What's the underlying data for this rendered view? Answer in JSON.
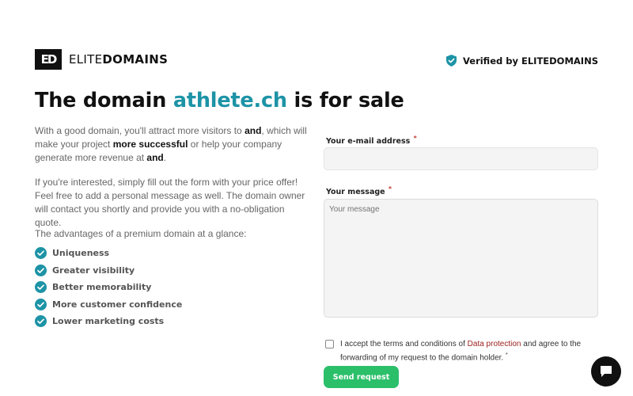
{
  "header": {
    "logo_mark": "ED",
    "logo_light": "ELITE",
    "logo_bold": "DOMAINS",
    "verified_text": "Verified by ELITEDOMAINS"
  },
  "title": {
    "prefix": "The domain ",
    "domain": "athlete.ch",
    "suffix": " is for sale"
  },
  "intro": {
    "p1_a": "With a good domain, you'll attract more visitors to ",
    "p1_b": "and",
    "p1_c": ", which will make your project ",
    "p1_d": "more successful",
    "p1_e": " or help your company generate more revenue at ",
    "p1_f": "and",
    "p1_g": ".",
    "p2": "If you're interested, simply fill out the form with your price offer! Feel free to add a personal message as well. The domain owner will contact you shortly and provide you with a no-obligation quote.",
    "p3": "The advantages of a premium domain at a glance:"
  },
  "advantages": [
    "Uniqueness",
    "Greater visibility",
    "Better memorability",
    "More customer confidence",
    "Lower marketing costs"
  ],
  "form": {
    "email_label": "Your e-mail address",
    "email_value": "",
    "message_label": "Your message",
    "message_placeholder": "Your message",
    "required_mark": "*",
    "terms_a": "I accept the terms and conditions of ",
    "terms_link": "Data protection",
    "terms_b": " and agree to the forwarding of my request to the domain holder.",
    "send_label": "Send request"
  },
  "colors": {
    "accent": "#1d93a6",
    "button": "#2bbf6a",
    "link": "#9b1c1c"
  },
  "icons": [
    "shield-check-icon",
    "check-circle-icon",
    "chat-icon"
  ]
}
